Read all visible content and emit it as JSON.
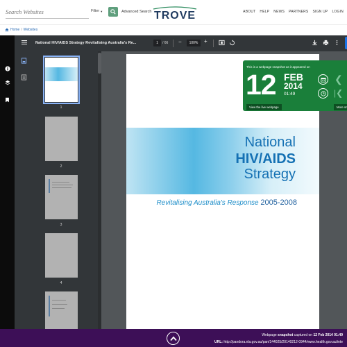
{
  "header": {
    "search_placeholder": "Search Websites",
    "filter_label": "Filter",
    "advanced_search": "Advanced Search",
    "logo_text": "TROVE",
    "nav": [
      "ABOUT",
      "HELP",
      "NEWS",
      "PARTNERS",
      "SIGN UP",
      "LOGIN"
    ]
  },
  "breadcrumb": {
    "home": "Home",
    "separator": "/",
    "current": "Websites"
  },
  "viewer": {
    "title": "National HIV/AIDS Strategy Revitalising Australia's Re...",
    "page": "1",
    "page_of": "/ 66",
    "zoom": "100%",
    "minus": "−",
    "plus": "+"
  },
  "thumbnails": {
    "labels": [
      "1",
      "2",
      "3",
      "4"
    ]
  },
  "document": {
    "title_line1": "National",
    "title_line2": "HIV/AIDS",
    "title_line3": "Strategy",
    "subtitle": "Revitalising Australia's Response",
    "years": "2005-2008"
  },
  "snapshot": {
    "caption": "This is a webpage snapshot as it appeared on",
    "day": "12",
    "month": "FEB",
    "year": "2014",
    "time": "01:49",
    "view_live": "View the live webpage",
    "more": "More sn"
  },
  "footer": {
    "line1_prefix": "Webpage",
    "line1_bold": "snapshot",
    "line1_mid": "captured on",
    "line1_date": "12 Feb 2014 01:49",
    "url_label": "URL:",
    "url": "http://pandora.nla.gov.au/pan/144025/20140212-0944/www.health.gov.au/inte"
  },
  "colors": {
    "accent_green": "#5f9f7d",
    "snapshot_green": "#1a7f3a",
    "footer_purple": "#3d0f57",
    "viewer_dark": "#323639",
    "link_blue": "#2a6bb4"
  }
}
